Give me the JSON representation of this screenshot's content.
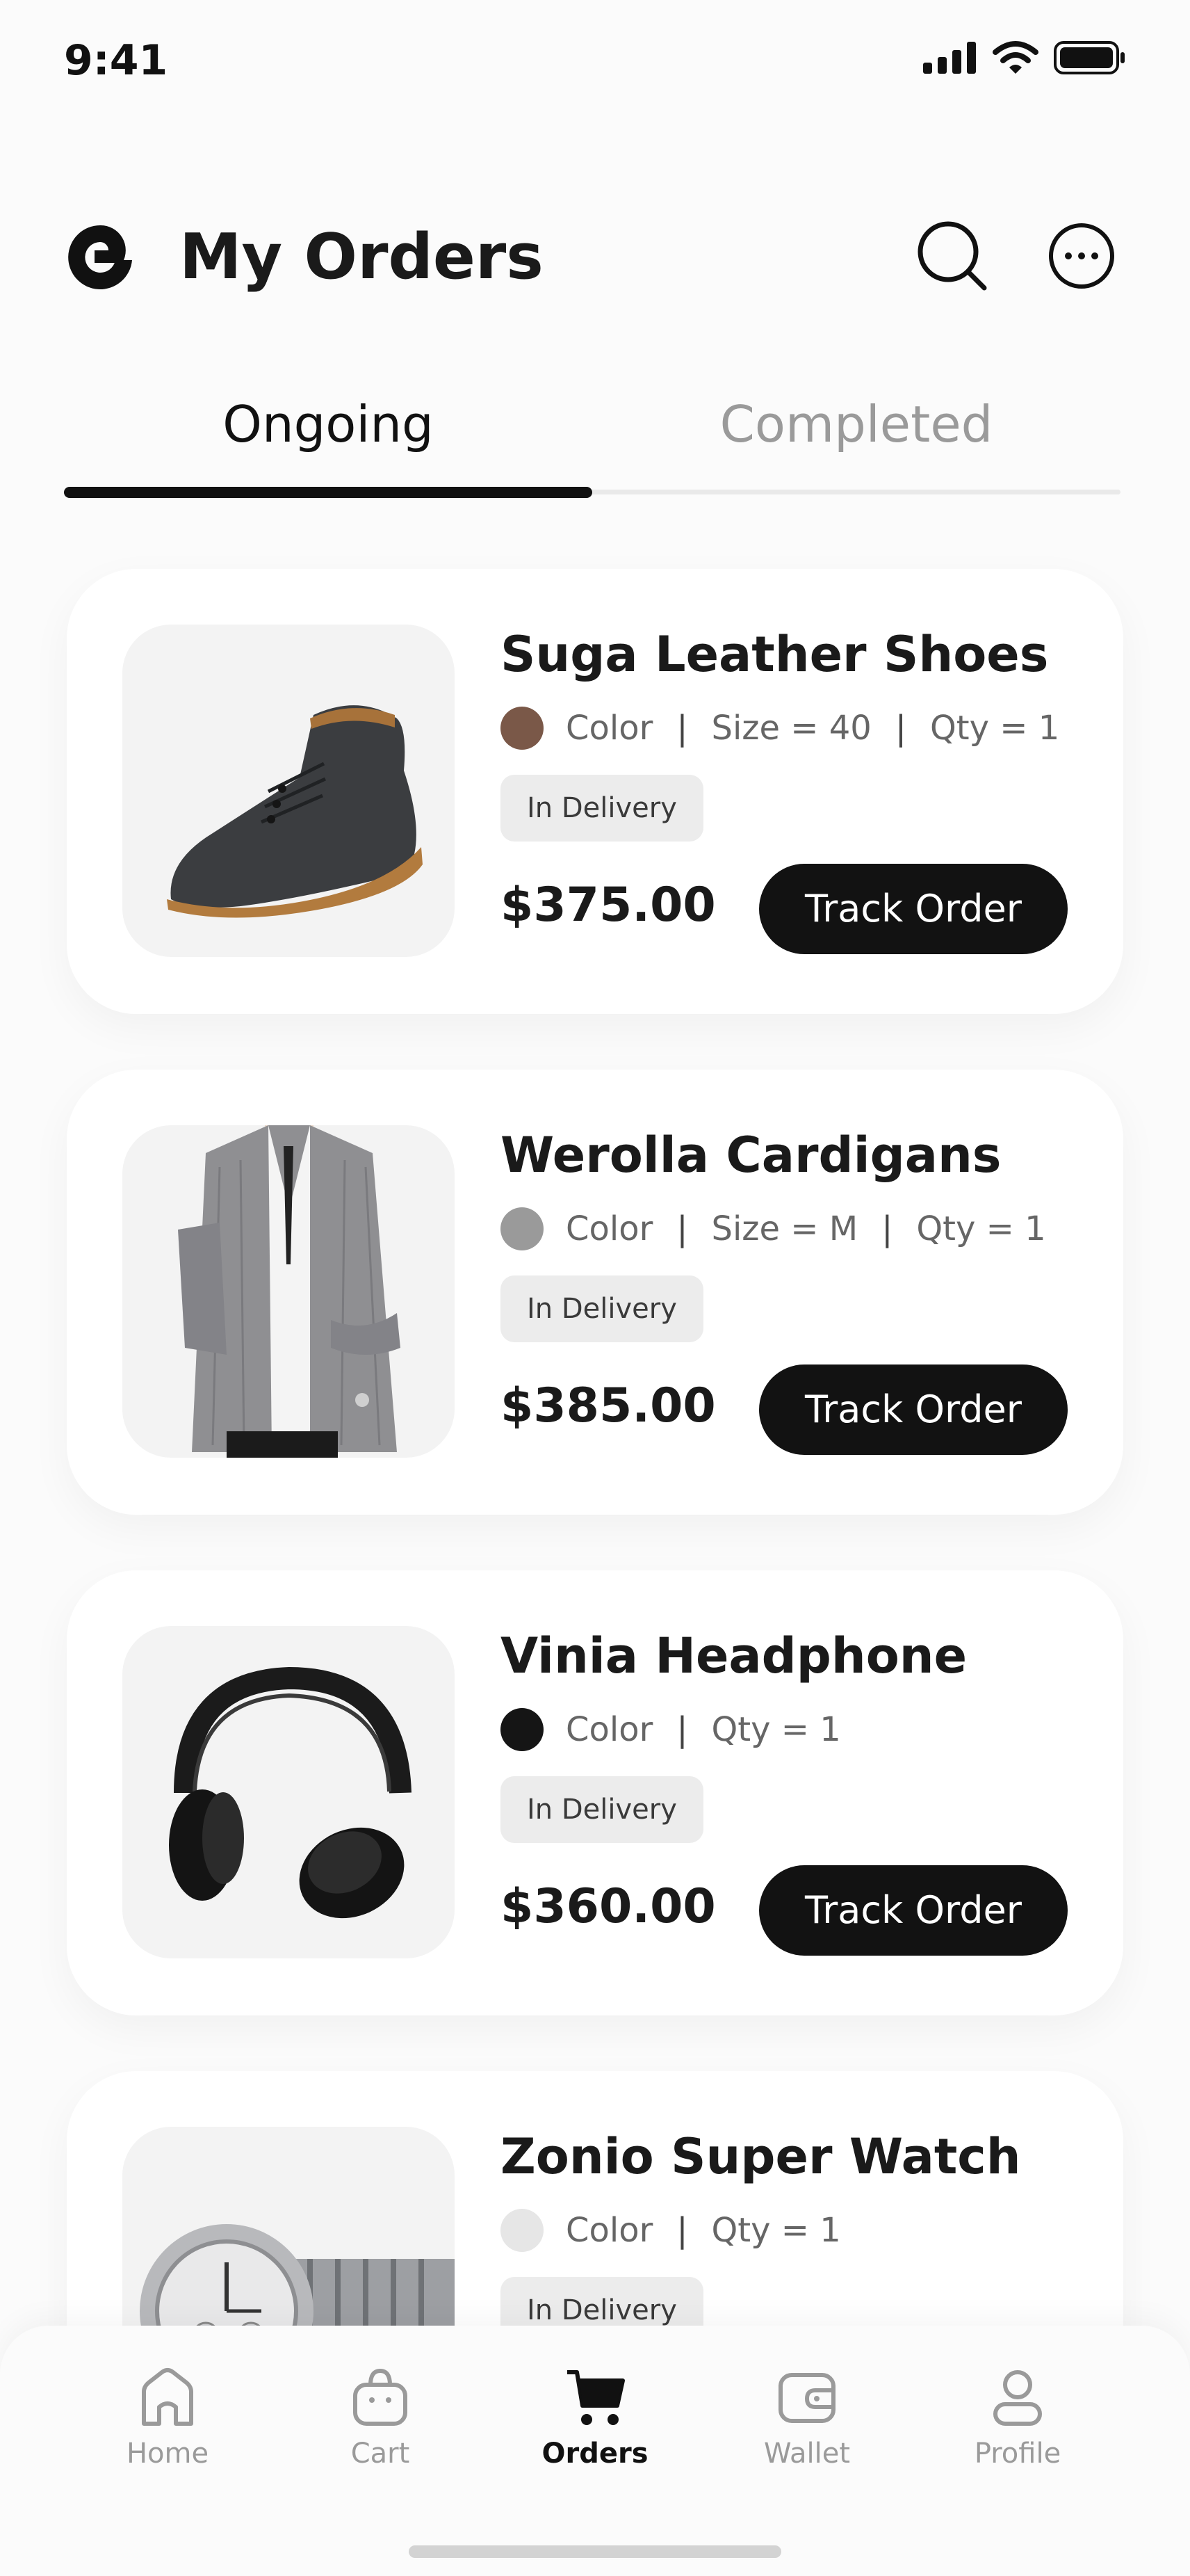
{
  "status_bar": {
    "time": "9:41"
  },
  "header": {
    "title": "My Orders",
    "logo_icon": "brand-swirl-icon",
    "search_icon": "search-icon",
    "more_icon": "more-options-icon"
  },
  "tabs": [
    {
      "label": "Ongoing",
      "active": true
    },
    {
      "label": "Completed",
      "active": false
    }
  ],
  "orders": [
    {
      "name": "Suga Leather Shoes",
      "color_hex": "#7a5848",
      "color_label": "Color",
      "size": "Size = 40",
      "qty": "Qty = 1",
      "status": "In Delivery",
      "price": "$375.00",
      "action": "Track Order",
      "image_icon": "leather-shoe-image"
    },
    {
      "name": "Werolla Cardigans",
      "color_hex": "#9a9a9a",
      "color_label": "Color",
      "size": "Size = M",
      "qty": "Qty = 1",
      "status": "In Delivery",
      "price": "$385.00",
      "action": "Track Order",
      "image_icon": "cardigan-image"
    },
    {
      "name": "Vinia Headphone",
      "color_hex": "#151515",
      "color_label": "Color",
      "qty": "Qty = 1",
      "status": "In Delivery",
      "price": "$360.00",
      "action": "Track Order",
      "image_icon": "headphone-image"
    },
    {
      "name": "Zonio Super Watch",
      "color_hex": "#e6e6e6",
      "color_label": "Color",
      "qty": "Qty = 1",
      "status": "In Delivery",
      "image_icon": "watch-image"
    }
  ],
  "bottom_nav": [
    {
      "label": "Home",
      "icon": "home-icon",
      "active": false
    },
    {
      "label": "Cart",
      "icon": "shopping-bag-icon",
      "active": false
    },
    {
      "label": "Orders",
      "icon": "cart-icon",
      "active": true
    },
    {
      "label": "Wallet",
      "icon": "wallet-icon",
      "active": false
    },
    {
      "label": "Profile",
      "icon": "profile-icon",
      "active": false
    }
  ],
  "colors": {
    "accent": "#111111",
    "inactive": "#9a9a9a",
    "badge_bg": "#ececec",
    "background": "#fbfbfb"
  }
}
